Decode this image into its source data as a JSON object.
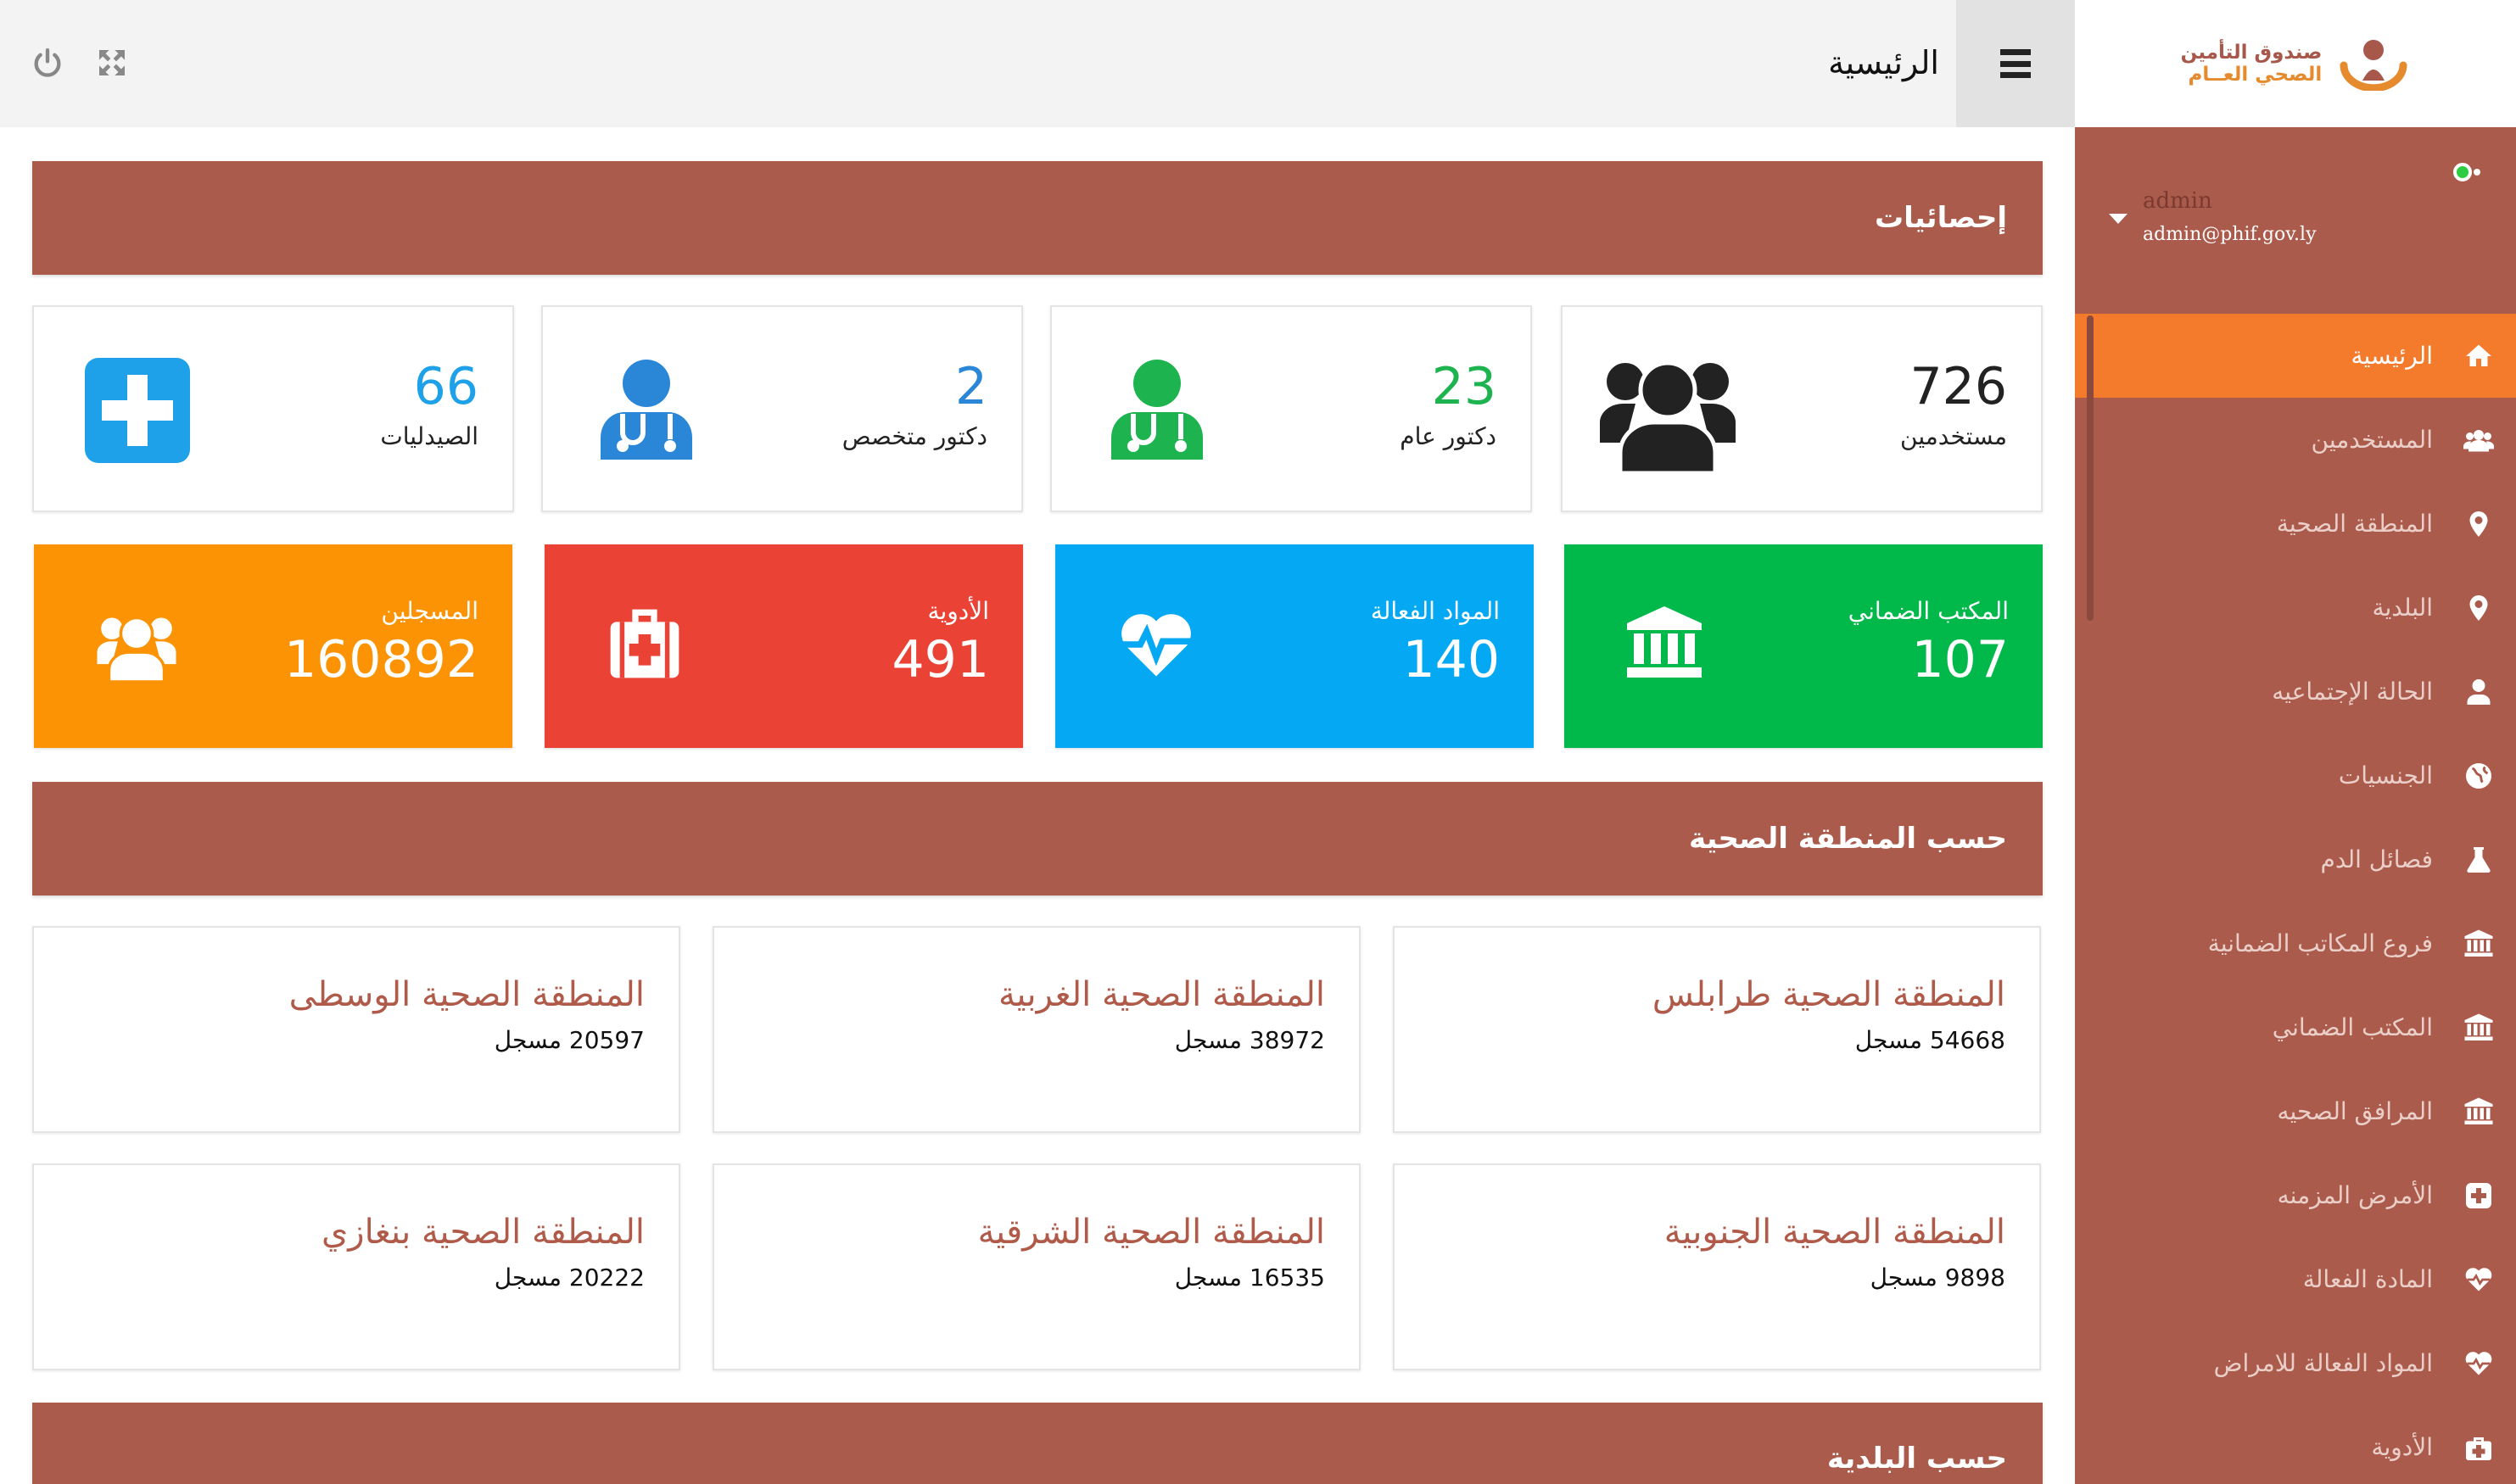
{
  "brand": {
    "line1": "صندوق التأمين",
    "line2": "الصحي العــام"
  },
  "header": {
    "title": "الرئيسية"
  },
  "user": {
    "name": "admin",
    "email": "admin@phif.gov.ly"
  },
  "sidebar": {
    "items": [
      {
        "label": "الرئيسية",
        "icon": "home-icon"
      },
      {
        "label": "المستخدمين",
        "icon": "users-icon"
      },
      {
        "label": "المنطقة الصحية",
        "icon": "map-marker-icon"
      },
      {
        "label": "البلدية",
        "icon": "map-marker-icon"
      },
      {
        "label": "الحالة الإجتماعيه",
        "icon": "user-icon"
      },
      {
        "label": "الجنسيات",
        "icon": "globe-icon"
      },
      {
        "label": "فصائل الدم",
        "icon": "flask-icon"
      },
      {
        "label": "فروع المكاتب الضمانية",
        "icon": "institution-icon"
      },
      {
        "label": "المكتب الضماني",
        "icon": "institution-icon"
      },
      {
        "label": "المرافق الصحيه",
        "icon": "institution-icon"
      },
      {
        "label": "الأمرض المزمنه",
        "icon": "plus-square-icon"
      },
      {
        "label": "المادة الفعالة",
        "icon": "heartbeat-icon"
      },
      {
        "label": "المواد الفعالة للامراض",
        "icon": "heartbeat-icon"
      },
      {
        "label": "الأدوية",
        "icon": "medkit-icon"
      }
    ]
  },
  "stats": {
    "title": "إحصائيات",
    "top_cards": [
      {
        "value": "726",
        "label": "مستخدمين",
        "color": "#222222",
        "icon": "users-icon"
      },
      {
        "value": "23",
        "label": "دكتور عام",
        "color": "#1db34f",
        "icon": "doctor-icon"
      },
      {
        "value": "2",
        "label": "دكتور متخصص",
        "color": "#2a86d6",
        "icon": "doctor-icon"
      },
      {
        "value": "66",
        "label": "الصيدليات",
        "color": "#1ea1e8",
        "icon": "pharmacy-plus-icon"
      }
    ],
    "color_cards": [
      {
        "label": "المكتب الضماني",
        "value": "107",
        "color": "#00b94a",
        "icon": "institution-icon"
      },
      {
        "label": "المواد الفعالة",
        "value": "140",
        "color": "#05a9f3",
        "icon": "heartbeat-icon"
      },
      {
        "label": "الأدوية",
        "value": "491",
        "color": "#eb4236",
        "icon": "medkit-icon"
      },
      {
        "label": "المسجلين",
        "value": "160892",
        "color": "#fb9304",
        "icon": "users-icon"
      }
    ]
  },
  "regions": {
    "title": "حسب المنطقة الصحية",
    "cards": [
      {
        "name": "المنطقة الصحية طرابلس",
        "count": "54668 مسجل"
      },
      {
        "name": "المنطقة الصحية الغربية",
        "count": "38972 مسجل"
      },
      {
        "name": "المنطقة الصحية الوسطى",
        "count": "20597 مسجل"
      },
      {
        "name": "المنطقة الصحية الجنوبية",
        "count": "9898 مسجل"
      },
      {
        "name": "المنطقة الصحية الشرقية",
        "count": "16535 مسجل"
      },
      {
        "name": "المنطقة الصحية بنغازي",
        "count": "20222 مسجل"
      }
    ]
  },
  "municipality": {
    "title": "حسب البلدية"
  }
}
